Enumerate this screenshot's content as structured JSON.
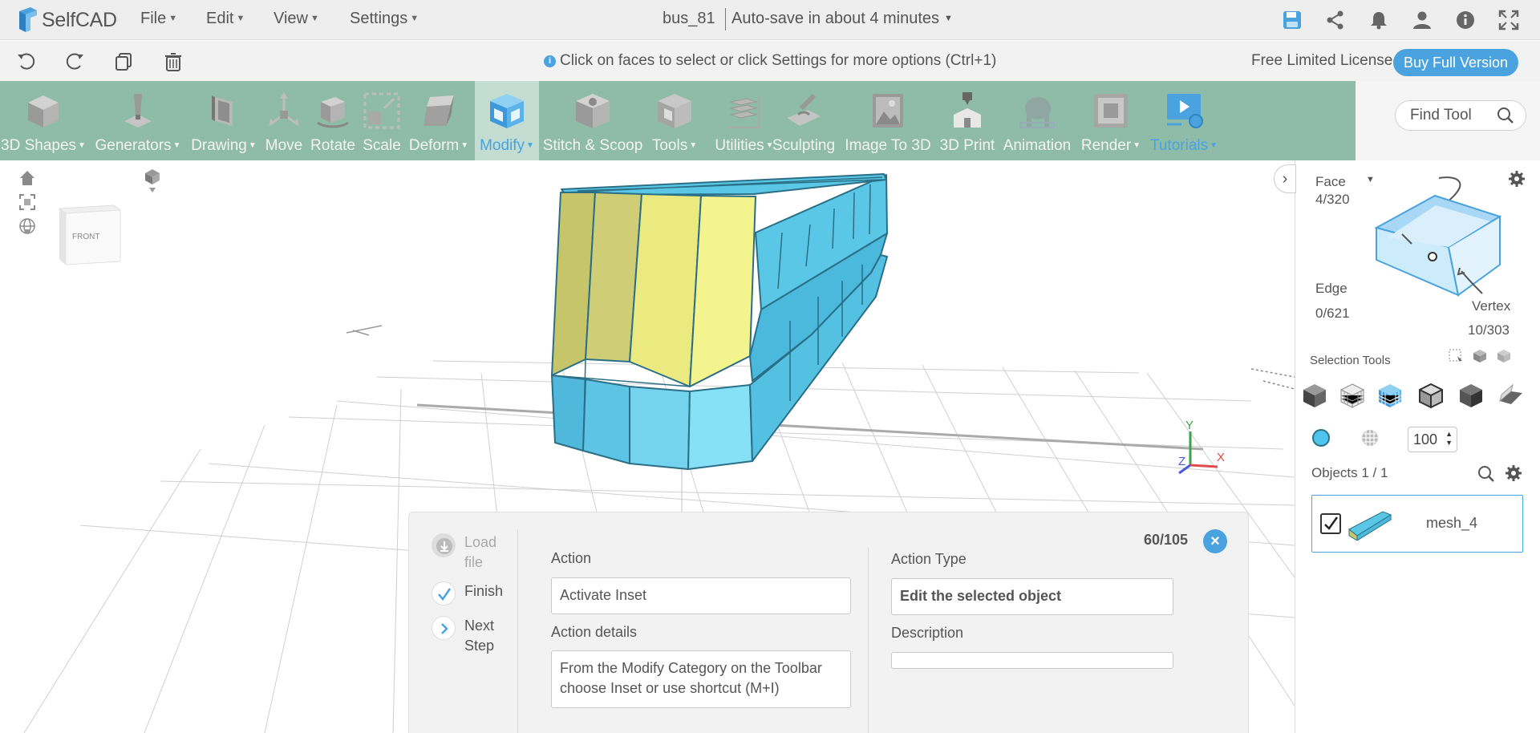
{
  "app": {
    "name": "SelfCAD"
  },
  "menu": {
    "file": "File",
    "edit": "Edit",
    "view": "View",
    "settings": "Settings"
  },
  "document": {
    "title": "bus_81",
    "autosave": "Auto-save in about 4 minutes"
  },
  "hint": {
    "text": "Click on faces to select or click Settings for more options (Ctrl+1)"
  },
  "license": {
    "label": "Free Limited License",
    "buy_label": "Buy Full Version"
  },
  "toolbar": {
    "items": [
      {
        "label": "3D Shapes",
        "icon": "cube-icon",
        "dropdown": true
      },
      {
        "label": "Generators",
        "icon": "generator-icon",
        "dropdown": true
      },
      {
        "label": "Drawing",
        "icon": "drawing-icon",
        "dropdown": true
      },
      {
        "label": "Move",
        "icon": "move-icon",
        "dropdown": false
      },
      {
        "label": "Rotate",
        "icon": "rotate-icon",
        "dropdown": false
      },
      {
        "label": "Scale",
        "icon": "scale-icon",
        "dropdown": false
      },
      {
        "label": "Deform",
        "icon": "deform-icon",
        "dropdown": true
      },
      {
        "label": "Modify",
        "icon": "modify-icon",
        "dropdown": true,
        "active": true
      },
      {
        "label": "Stitch & Scoop",
        "icon": "stitch-icon",
        "dropdown": false
      },
      {
        "label": "Tools",
        "icon": "tools-icon",
        "dropdown": true
      },
      {
        "label": "Utilities",
        "icon": "utilities-icon",
        "dropdown": true
      },
      {
        "label": "Sculpting",
        "icon": "sculpting-icon",
        "dropdown": false
      },
      {
        "label": "Image To 3D",
        "icon": "image-to-3d-icon",
        "dropdown": false
      },
      {
        "label": "3D Print",
        "icon": "printer-icon",
        "dropdown": false
      },
      {
        "label": "Animation",
        "icon": "animation-icon",
        "dropdown": false
      },
      {
        "label": "Render",
        "icon": "render-icon",
        "dropdown": true
      },
      {
        "label": "Tutorials",
        "icon": "tutorial-icon",
        "dropdown": true
      }
    ],
    "find_placeholder": "Find Tool"
  },
  "viewcube": {
    "face_label": "FRONT"
  },
  "axes": {
    "x": "X",
    "y": "Y",
    "z": "Z"
  },
  "selection": {
    "face_label": "Face",
    "face_count": "4/320",
    "edge_label": "Edge",
    "edge_count": "0/621",
    "vertex_label": "Vertex",
    "vertex_count": "10/303",
    "tools_label": "Selection Tools",
    "opacity_value": "100",
    "accent_color": "#4aa3df"
  },
  "objects": {
    "header": "Objects 1 / 1",
    "items": [
      {
        "name": "mesh_4",
        "checked": true
      }
    ]
  },
  "tutorial": {
    "steps": [
      {
        "label": "Load file",
        "state": "disabled"
      },
      {
        "label": "Finish",
        "state": "done"
      },
      {
        "label": "Next Step",
        "state": "next"
      }
    ],
    "counter": "60/105",
    "action_label": "Action",
    "action_value": "Activate Inset",
    "action_details_label": "Action details",
    "action_details_value": "From the Modify Category on the Toolbar choose Inset or use shortcut (M+I)",
    "action_type_label": "Action Type",
    "action_type_value": "Edit the selected object",
    "description_label": "Description",
    "description_value": ""
  },
  "colors": {
    "toolbar_bg": "#8fbca8",
    "accent": "#4aa3df",
    "mesh": "#6ed3ec",
    "mesh_selected": "#f2f28a"
  }
}
